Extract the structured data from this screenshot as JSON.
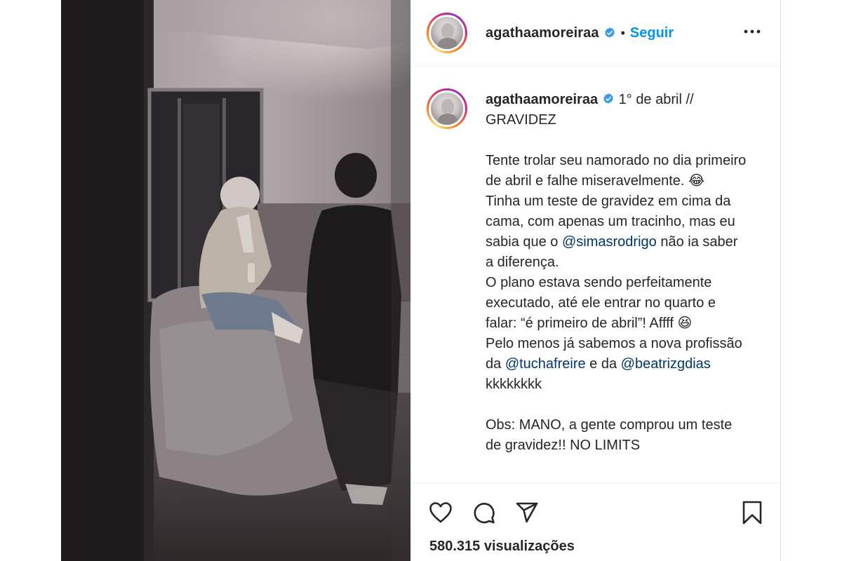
{
  "post": {
    "username": "agathaamoreiraa",
    "verified": true,
    "separator": "•",
    "follow_label": "Seguir",
    "more_icon": "more-options-icon"
  },
  "caption": {
    "username": "agathaamoreiraa",
    "title": " 1° de abril // GRAVIDEZ",
    "p1a": "Tente trolar seu namorado no dia primeiro de abril e falhe miseravelmente. ",
    "emoji1": "😂",
    "p1b": "Tinha um teste de gravidez em cima da cama, com apenas um tracinho, mas eu sabia que o ",
    "mention1": "@simasrodrigo",
    "p1c": " não ia saber a diferença.",
    "p2": "O plano estava sendo perfeitamente executado, até ele entrar no quarto e falar: “é primeiro de abril”! Affff ",
    "emoji2": "😆",
    "p3a": "Pelo menos já sabemos a nova profissão da ",
    "mention2": "@tuchafreire",
    "p3b": " e da ",
    "mention3": "@beatrizgdias",
    "p3c": " kkkkkkkk",
    "obs": "Obs: MANO, a gente comprou um teste de gravidez!! NO LIMITS"
  },
  "actions": {
    "like_icon": "heart-icon",
    "comment_icon": "comment-icon",
    "share_icon": "share-icon",
    "save_icon": "bookmark-icon"
  },
  "stats": {
    "views": "580.315 visualizações"
  },
  "colors": {
    "accent": "#0095f6",
    "mention": "#00376b",
    "text": "#262626",
    "verified": "#3897f0"
  }
}
